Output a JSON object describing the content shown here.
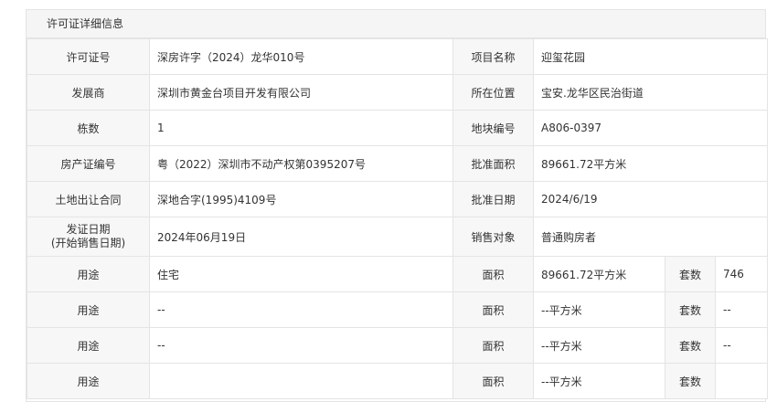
{
  "panel": {
    "title": "许可证详细信息"
  },
  "info_rows": [
    {
      "label1": "许可证号",
      "value1": "深房许字（2024）龙华010号",
      "label2": "项目名称",
      "value2": "迎玺花园"
    },
    {
      "label1": "发展商",
      "value1": "深圳市黄金台项目开发有限公司",
      "label2": "所在位置",
      "value2": "宝安.龙华区民治街道"
    },
    {
      "label1": "栋数",
      "value1": "1",
      "label2": "地块编号",
      "value2": "A806-0397"
    },
    {
      "label1": "房产证编号",
      "value1": "粤（2022）深圳市不动产权第0395207号",
      "label2": "批准面积",
      "value2": "89661.72平方米"
    },
    {
      "label1": "土地出让合同",
      "value1": "深地合字(1995)4109号",
      "label2": "批准日期",
      "value2": "2024/6/19"
    }
  ],
  "issue_row": {
    "label_line1": "发证日期",
    "label_line2": "(开始销售日期)",
    "value1": "2024年06月19日",
    "label2": "销售对象",
    "value2": "普通购房者"
  },
  "usage_rows": [
    {
      "label": "用途",
      "usage": "住宅",
      "area_label": "面积",
      "area": "89661.72平方米",
      "units_label": "套数",
      "units": "746"
    },
    {
      "label": "用途",
      "usage": "--",
      "area_label": "面积",
      "area": "--平方米",
      "units_label": "套数",
      "units": "--"
    },
    {
      "label": "用途",
      "usage": "--",
      "area_label": "面积",
      "area": "--平方米",
      "units_label": "套数",
      "units": "--"
    },
    {
      "label": "用途",
      "usage": "",
      "area_label": "面积",
      "area": "--平方米",
      "units_label": "套数",
      "units": ""
    }
  ]
}
